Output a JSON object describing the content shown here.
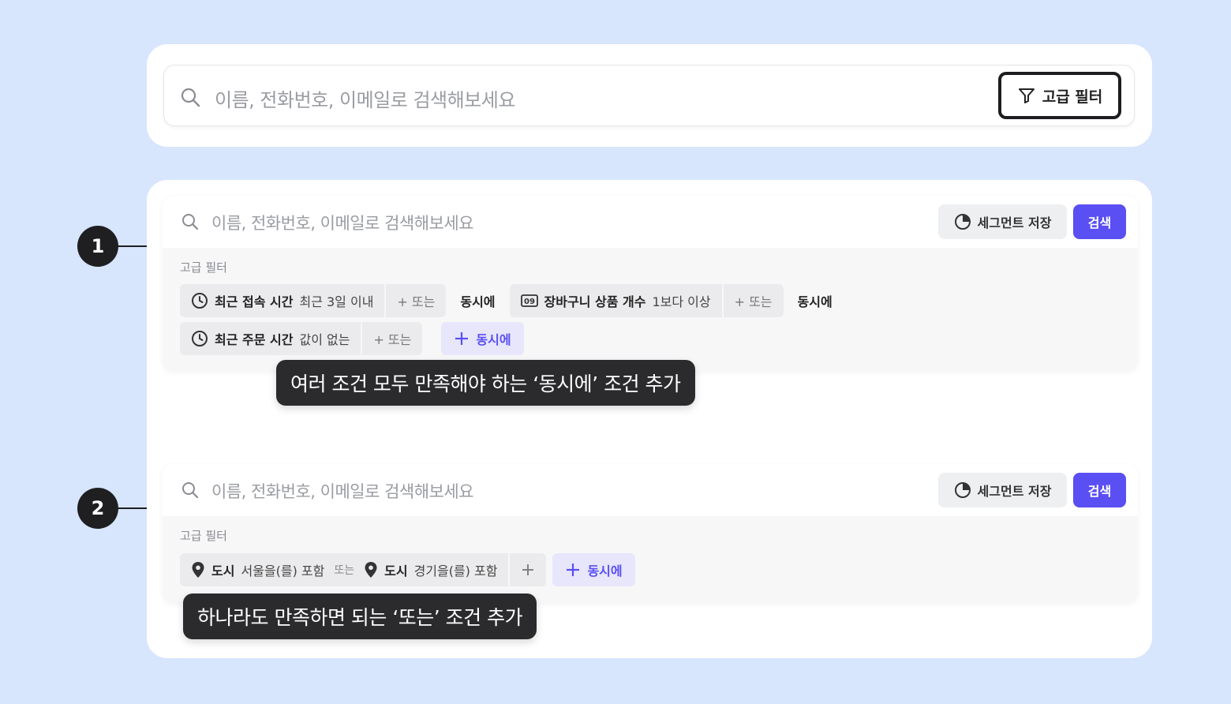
{
  "top": {
    "search_placeholder": "이름, 전화번호, 이메일로 검색해보세요",
    "advanced_filter_label": "고급 필터"
  },
  "panels": [
    {
      "marker": "1",
      "search_placeholder": "이름, 전화번호, 이메일로 검색해보세요",
      "segment_save_label": "세그먼트 저장",
      "search_button_label": "검색",
      "filter_title": "고급 필터",
      "row1": {
        "chip1": {
          "icon": "clock-icon",
          "name": "최근 접속 시간",
          "value": "최근 3일 이내",
          "or_label": "+ 또는"
        },
        "and_label_1": "동시에",
        "chip2": {
          "icon": "number-icon",
          "icon_text": "09",
          "name": "장바구니 상품 개수",
          "value": "1보다 이상",
          "or_label": "+ 또는"
        },
        "and_label_2": "동시에"
      },
      "row2": {
        "chip1": {
          "icon": "clock-icon",
          "name": "최근 주문 시간",
          "value": "값이 없는",
          "or_label": "+ 또는"
        },
        "add_and_label": "동시에"
      },
      "tooltip": "여러 조건 모두 만족해야 하는 ‘동시에’ 조건 추가"
    },
    {
      "marker": "2",
      "search_placeholder": "이름, 전화번호, 이메일로 검색해보세요",
      "segment_save_label": "세그먼트 저장",
      "search_button_label": "검색",
      "filter_title": "고급 필터",
      "row1": {
        "chip1": {
          "icon": "location-pin-icon",
          "name": "도시",
          "value": "서울을(를) 포함"
        },
        "or_inline": "또는",
        "chip2": {
          "icon": "location-pin-icon",
          "name": "도시",
          "value": "경기을(를) 포함"
        },
        "add_and_label": "동시에"
      },
      "tooltip": "하나라도 만족하면 되는 ‘또는’ 조건 추가"
    }
  ],
  "colors": {
    "background": "#d7e5fd",
    "accent": "#5a4ff3",
    "tooltip_bg": "#2b2b2d"
  }
}
